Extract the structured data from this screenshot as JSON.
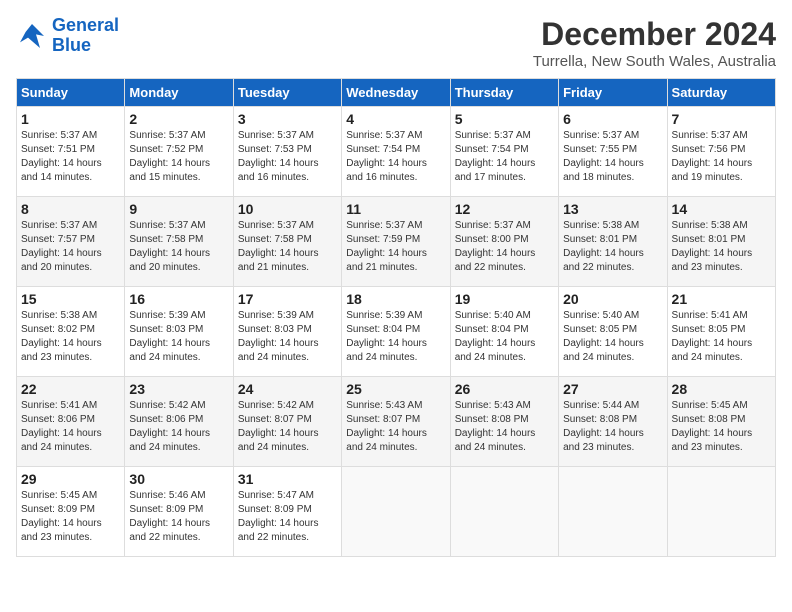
{
  "header": {
    "logo_line1": "General",
    "logo_line2": "Blue",
    "month_title": "December 2024",
    "subtitle": "Turrella, New South Wales, Australia"
  },
  "weekdays": [
    "Sunday",
    "Monday",
    "Tuesday",
    "Wednesday",
    "Thursday",
    "Friday",
    "Saturday"
  ],
  "weeks": [
    [
      {
        "day": "1",
        "sunrise": "5:37 AM",
        "sunset": "7:51 PM",
        "daylight": "14 hours and 14 minutes."
      },
      {
        "day": "2",
        "sunrise": "5:37 AM",
        "sunset": "7:52 PM",
        "daylight": "14 hours and 15 minutes."
      },
      {
        "day": "3",
        "sunrise": "5:37 AM",
        "sunset": "7:53 PM",
        "daylight": "14 hours and 16 minutes."
      },
      {
        "day": "4",
        "sunrise": "5:37 AM",
        "sunset": "7:54 PM",
        "daylight": "14 hours and 16 minutes."
      },
      {
        "day": "5",
        "sunrise": "5:37 AM",
        "sunset": "7:54 PM",
        "daylight": "14 hours and 17 minutes."
      },
      {
        "day": "6",
        "sunrise": "5:37 AM",
        "sunset": "7:55 PM",
        "daylight": "14 hours and 18 minutes."
      },
      {
        "day": "7",
        "sunrise": "5:37 AM",
        "sunset": "7:56 PM",
        "daylight": "14 hours and 19 minutes."
      }
    ],
    [
      {
        "day": "8",
        "sunrise": "5:37 AM",
        "sunset": "7:57 PM",
        "daylight": "14 hours and 20 minutes."
      },
      {
        "day": "9",
        "sunrise": "5:37 AM",
        "sunset": "7:58 PM",
        "daylight": "14 hours and 20 minutes."
      },
      {
        "day": "10",
        "sunrise": "5:37 AM",
        "sunset": "7:58 PM",
        "daylight": "14 hours and 21 minutes."
      },
      {
        "day": "11",
        "sunrise": "5:37 AM",
        "sunset": "7:59 PM",
        "daylight": "14 hours and 21 minutes."
      },
      {
        "day": "12",
        "sunrise": "5:37 AM",
        "sunset": "8:00 PM",
        "daylight": "14 hours and 22 minutes."
      },
      {
        "day": "13",
        "sunrise": "5:38 AM",
        "sunset": "8:01 PM",
        "daylight": "14 hours and 22 minutes."
      },
      {
        "day": "14",
        "sunrise": "5:38 AM",
        "sunset": "8:01 PM",
        "daylight": "14 hours and 23 minutes."
      }
    ],
    [
      {
        "day": "15",
        "sunrise": "5:38 AM",
        "sunset": "8:02 PM",
        "daylight": "14 hours and 23 minutes."
      },
      {
        "day": "16",
        "sunrise": "5:39 AM",
        "sunset": "8:03 PM",
        "daylight": "14 hours and 24 minutes."
      },
      {
        "day": "17",
        "sunrise": "5:39 AM",
        "sunset": "8:03 PM",
        "daylight": "14 hours and 24 minutes."
      },
      {
        "day": "18",
        "sunrise": "5:39 AM",
        "sunset": "8:04 PM",
        "daylight": "14 hours and 24 minutes."
      },
      {
        "day": "19",
        "sunrise": "5:40 AM",
        "sunset": "8:04 PM",
        "daylight": "14 hours and 24 minutes."
      },
      {
        "day": "20",
        "sunrise": "5:40 AM",
        "sunset": "8:05 PM",
        "daylight": "14 hours and 24 minutes."
      },
      {
        "day": "21",
        "sunrise": "5:41 AM",
        "sunset": "8:05 PM",
        "daylight": "14 hours and 24 minutes."
      }
    ],
    [
      {
        "day": "22",
        "sunrise": "5:41 AM",
        "sunset": "8:06 PM",
        "daylight": "14 hours and 24 minutes."
      },
      {
        "day": "23",
        "sunrise": "5:42 AM",
        "sunset": "8:06 PM",
        "daylight": "14 hours and 24 minutes."
      },
      {
        "day": "24",
        "sunrise": "5:42 AM",
        "sunset": "8:07 PM",
        "daylight": "14 hours and 24 minutes."
      },
      {
        "day": "25",
        "sunrise": "5:43 AM",
        "sunset": "8:07 PM",
        "daylight": "14 hours and 24 minutes."
      },
      {
        "day": "26",
        "sunrise": "5:43 AM",
        "sunset": "8:08 PM",
        "daylight": "14 hours and 24 minutes."
      },
      {
        "day": "27",
        "sunrise": "5:44 AM",
        "sunset": "8:08 PM",
        "daylight": "14 hours and 23 minutes."
      },
      {
        "day": "28",
        "sunrise": "5:45 AM",
        "sunset": "8:08 PM",
        "daylight": "14 hours and 23 minutes."
      }
    ],
    [
      {
        "day": "29",
        "sunrise": "5:45 AM",
        "sunset": "8:09 PM",
        "daylight": "14 hours and 23 minutes."
      },
      {
        "day": "30",
        "sunrise": "5:46 AM",
        "sunset": "8:09 PM",
        "daylight": "14 hours and 22 minutes."
      },
      {
        "day": "31",
        "sunrise": "5:47 AM",
        "sunset": "8:09 PM",
        "daylight": "14 hours and 22 minutes."
      },
      null,
      null,
      null,
      null
    ]
  ]
}
